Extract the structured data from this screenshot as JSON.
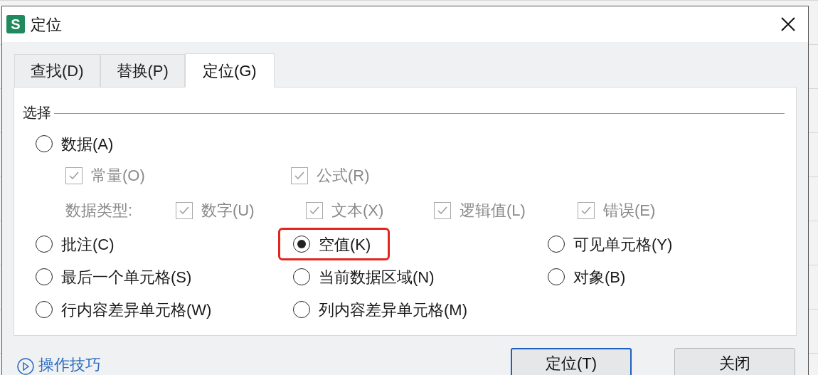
{
  "window": {
    "title": "定位",
    "app_icon": "S"
  },
  "tabs": [
    {
      "label": "查找(D)",
      "selected": false
    },
    {
      "label": "替换(P)",
      "selected": false
    },
    {
      "label": "定位(G)",
      "selected": true
    }
  ],
  "group": {
    "title": "选择"
  },
  "data_option": {
    "label": "数据(A)",
    "selected": false
  },
  "sub_options": [
    {
      "label": "常量(O)",
      "checked": true,
      "disabled": true
    },
    {
      "label": "公式(R)",
      "checked": true,
      "disabled": true
    }
  ],
  "data_types": {
    "label": "数据类型:",
    "disabled": true,
    "items": [
      {
        "label": "数字(U)",
        "checked": true
      },
      {
        "label": "文本(X)",
        "checked": true
      },
      {
        "label": "逻辑值(L)",
        "checked": true
      },
      {
        "label": "错误(E)",
        "checked": true
      }
    ]
  },
  "options": [
    {
      "label": "批注(C)",
      "selected": false,
      "highlighted": false
    },
    {
      "label": "空值(K)",
      "selected": true,
      "highlighted": true
    },
    {
      "label": "可见单元格(Y)",
      "selected": false,
      "highlighted": false
    },
    {
      "label": "最后一个单元格(S)",
      "selected": false,
      "highlighted": false
    },
    {
      "label": "当前数据区域(N)",
      "selected": false,
      "highlighted": false
    },
    {
      "label": "对象(B)",
      "selected": false,
      "highlighted": false
    },
    {
      "label": "行内容差异单元格(W)",
      "selected": false,
      "highlighted": false
    },
    {
      "label": "列内容差异单元格(M)",
      "selected": false,
      "highlighted": false
    }
  ],
  "tips_link": "操作技巧",
  "buttons": [
    {
      "label": "定位(T)",
      "default": true
    },
    {
      "label": "关闭",
      "default": false
    }
  ]
}
